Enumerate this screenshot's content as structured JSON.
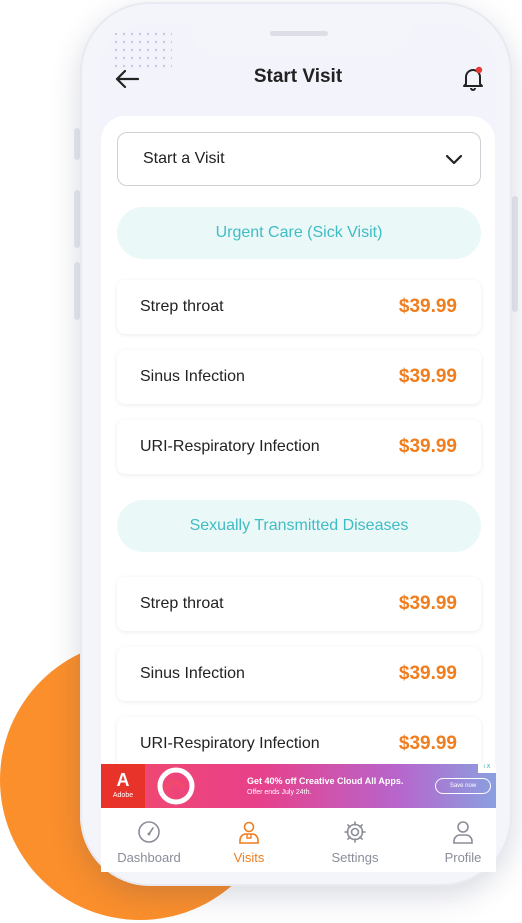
{
  "header": {
    "title": "Start Visit"
  },
  "select": {
    "value": "Start a Visit"
  },
  "sections": [
    {
      "title": "Urgent Care (Sick Visit)",
      "items": [
        {
          "name": "Strep throat",
          "price": "$39.99"
        },
        {
          "name": "Sinus Infection",
          "price": "$39.99"
        },
        {
          "name": "URI-Respiratory Infection",
          "price": "$39.99"
        }
      ]
    },
    {
      "title": "Sexually Transmitted Diseases",
      "items": [
        {
          "name": "Strep throat",
          "price": "$39.99"
        },
        {
          "name": "Sinus Infection",
          "price": "$39.99"
        },
        {
          "name": "URI-Respiratory Infection",
          "price": "$39.99"
        }
      ]
    }
  ],
  "ad": {
    "brand": "Adobe",
    "headline": "Get 40% off Creative Cloud All Apps.",
    "subline": "Offer ends July 24th.",
    "button": "Save now",
    "mark": "i X"
  },
  "tabs": [
    {
      "label": "Dashboard",
      "icon": "gauge-icon",
      "active": false
    },
    {
      "label": "Visits",
      "icon": "doctor-icon",
      "active": true
    },
    {
      "label": "Settings",
      "icon": "gear-icon",
      "active": false
    },
    {
      "label": "Profile",
      "icon": "person-icon",
      "active": false
    }
  ],
  "colors": {
    "accent": "#f07d1e",
    "teal": "#3fbcc4",
    "sectionBg": "#ebf8f8",
    "blob": "#fb8f2c"
  }
}
